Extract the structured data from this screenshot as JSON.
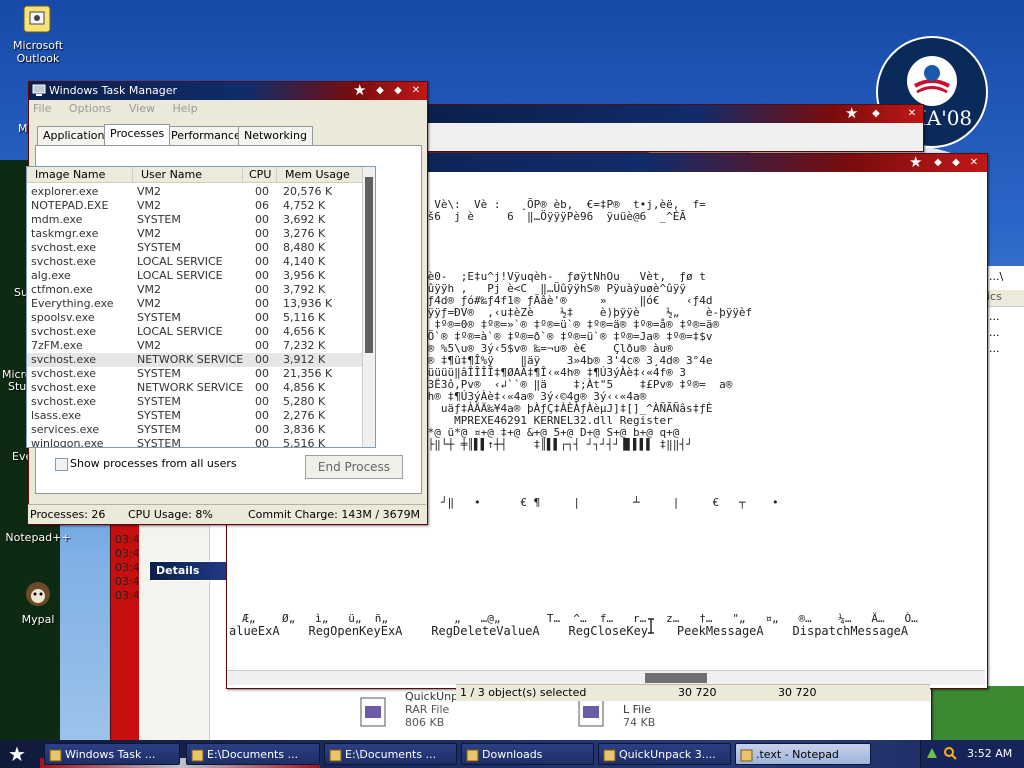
{
  "desktop": {
    "icons": [
      {
        "label": "Microsoft\nOutlook"
      },
      {
        "label": "Notepad++"
      },
      {
        "label": "Mypal"
      }
    ],
    "partial_labels": [
      "M",
      "Sup",
      "Micro",
      "Stud",
      "Eve"
    ],
    "badge_text": "AMA'08"
  },
  "task_manager": {
    "title": "Windows Task Manager",
    "menu": [
      "File",
      "Options",
      "View",
      "Help"
    ],
    "tabs": [
      "Applications",
      "Processes",
      "Performance",
      "Networking"
    ],
    "active_tab": "Processes",
    "columns": [
      "Image Name",
      "User Name",
      "CPU",
      "Mem Usage"
    ],
    "processes": [
      [
        "explorer.exe",
        "VM2",
        "00",
        "20,576 K"
      ],
      [
        "NOTEPAD.EXE",
        "VM2",
        "06",
        "4,752 K"
      ],
      [
        "mdm.exe",
        "SYSTEM",
        "00",
        "3,692 K"
      ],
      [
        "taskmgr.exe",
        "VM2",
        "00",
        "3,276 K"
      ],
      [
        "svchost.exe",
        "SYSTEM",
        "00",
        "8,480 K"
      ],
      [
        "svchost.exe",
        "LOCAL SERVICE",
        "00",
        "4,140 K"
      ],
      [
        "alg.exe",
        "LOCAL SERVICE",
        "00",
        "3,956 K"
      ],
      [
        "ctfmon.exe",
        "VM2",
        "00",
        "3,792 K"
      ],
      [
        "Everything.exe",
        "VM2",
        "00",
        "13,936 K"
      ],
      [
        "spoolsv.exe",
        "SYSTEM",
        "00",
        "5,116 K"
      ],
      [
        "svchost.exe",
        "LOCAL SERVICE",
        "00",
        "4,656 K"
      ],
      [
        "7zFM.exe",
        "VM2",
        "00",
        "7,232 K"
      ],
      [
        "svchost.exe",
        "NETWORK SERVICE",
        "00",
        "3,912 K"
      ],
      [
        "svchost.exe",
        "SYSTEM",
        "00",
        "21,356 K"
      ],
      [
        "svchost.exe",
        "NETWORK SERVICE",
        "00",
        "4,856 K"
      ],
      [
        "svchost.exe",
        "SYSTEM",
        "00",
        "5,280 K"
      ],
      [
        "lsass.exe",
        "SYSTEM",
        "00",
        "2,276 K"
      ],
      [
        "services.exe",
        "SYSTEM",
        "00",
        "3,836 K"
      ],
      [
        "winlogon.exe",
        "SYSTEM",
        "00",
        "5,516 K"
      ]
    ],
    "show_all_label": "Show processes from all users",
    "end_process_label": "End Process",
    "status": {
      "processes": "Processes: 26",
      "cpu": "CPU Usage: 8%",
      "commit": "Commit Charge: 143M / 3679M"
    }
  },
  "notepad": {
    "lines": [
      "ýtâ‹ðj,j j vèÙ9  j h‡S® j‡hâR® Vè\\:  Vè :   ¸ÕP® èb,  €=‡P®  t•j,èë,  f=",
      "  ↲j j j j Vè36  …ÀèP6  t¢yüüèš6  j è     6  ‖…ÖÿÿÿPè96  ÿuüè@6  _^ÉÃ",
      "",
      "",
      "ýyÿ‹   éš-   …À‹ðtyj ÿuÿu‡ÿuÿuè0-  ;E‡u^j!Vÿuqèh-  ƒøÿtNhOu   Vèt,  ƒø t",
      "þEÜ€}Üÿ¢…\"ÿÿÿèm, ¢-…øÜÿÿ%Eäu…Üûÿÿh ,   Pj è<C  ‖…ÜûÿÿhS® Pÿuàÿuøè^ûÿÿ",
      "‹E#C%E#Ue #  ƒÀ'°     »    ƒó‹ƒ4d® ƒó#‰ƒ4f1® ƒÃâè'®     »     ‖ó€    ‹ƒ4d",
      "ÿè   ½‡    èRþÿÿè    ½‡    èCþÿÿƒ=ÐV®  ‚‹u‡èZè    ½‡    è)þÿÿè    ½„    è-þÿÿèf",
      "@ ‡º®=ü`® ‡º®=ä® ‡º®=å® ‡º®=ä® ‡º®=0® ‡º®=»`® ‡º®=ü`® ‡º®=ä® ‡º®=å® ‡º®=ä®",
      "@ ‡º®=°`® ‡º®=¼`® ‡º®=À`® ‡º®=Õ`® ‡º®=à`® ‡º®=ð`® ‡º®=ü`® ‡º®=Ja® ‡º®=‡$v",
      "@ èu® <5\\u® <–Àu® <=¬u® 3ô‹–¤u® %5\\u® 3ý‹5$v® ‰=¬u® è€    Çlðu® àu®",
      "@ ‡¶ÚÀè‡3'4f® ‡¶ÎÀè‡3›4a® 3'4g® ‡¶ü‡¶Î%ÿ    ‖äÿ    3»4b® 3'4c® 3¸4d® 3°4e",
      " 4d® 3ô‹ª4e® 3ô¡Ð`® 3Æ‹Ó`® 3Ò%üüüü‖âÎÎÎÎ‡¶ØAÀ‡¶Î‹«4h® ‡¶Ú3ýÀè‡‹«4f® 3",
      "   ‖ñ€    ‹=˜u® ‹«4e® 3ô‹©4g® 3Ë3ô‚Pv®  ‹↲``® ‖ä    ‡;Àt\"5    ‡£Pv® ‡º®=  a®",
      "Æ‹⊥u® 3Ô%üüüü‖âÎÎÎÎ‡¶ØAÀ‡¶Î‹«4h® ‡¶Ú3ýÀè‡‹«4a® 3ý‹©4g® 3ý‹‹«4a®",
      "ÐÀ‚T‚ŸÐàs‡$Š`U® °‚   ÓËÙÈ–Ä‹    uäƒ‡ÀÄÄ‰¥4a® þÀƒÇ‡ÀÈÀƒÀèµJ]‡[]_^ÀÑÃÑâs‡ƒÈ",
      "                             •    MPREXE46291 KERNEL32.dll Register",
      "ÿßÿÿ?‚   Ã–@ ®*@ ½*@ Ì*@ Ó*@ è*@ ü*@ ¤+@ ‡+@ &+@ 5+@ D+@ S+@ b+@ q+@",
      "┴┘‖‖┌┘‖ ‡┐┼┼‖─═╦═▐┨▌◄◄▌▌▌▌‖║┼┤├‖└┼ ╪║▌▌↑┼┤    ‡║▌▌┌┐┤ ┘┐┘┤┘▐▌▌▌▌ ‡‖‖┤┘"
    ],
    "mid_symbols": "     ┐◄   |      ┘ ┬     |      ┘‖   •      € ¶     |        ┴     |     €   ┬    •",
    "sym_line": "  Æ„    Ø„   ì„   ü„  ñ„          „   …@„       T…  ^…  f…   r…   z…   †…   \"„   ¤„   ®…    ¼…   Ä…   Ò…",
    "api_line": "alueExA    RegOpenKeyExA    RegDeleteValueA    RegCloseKey    PeekMessageA    DispatchMessageA"
  },
  "explorer_bits": {
    "status_text": "1 / 3 object(s) selected",
    "size1": "30 720",
    "size2": "30 720",
    "times": [
      "03:4",
      "03:4",
      "03:4",
      "03:4",
      "03:4"
    ],
    "details_label": "Details",
    "files": [
      {
        "name": "QuickUnpack",
        "type": "RAR File",
        "size": "806 KB"
      },
      {
        "name": "L File",
        "type": "",
        "size": "74 KB"
      }
    ],
    "side_frags": [
      "...\\",
      "...",
      "...",
      "..."
    ],
    "ics": "ics"
  },
  "taskbar": {
    "tasks": [
      {
        "label": "Windows Task ...",
        "active": false
      },
      {
        "label": "E:\\Documents ...",
        "active": false
      },
      {
        "label": "E:\\Documents ...",
        "active": false
      },
      {
        "label": "Downloads",
        "active": false
      },
      {
        "label": "QuickUnpack 3....",
        "active": false
      },
      {
        "label": ".text - Notepad",
        "active": true
      }
    ],
    "clock": "3:52 AM"
  }
}
